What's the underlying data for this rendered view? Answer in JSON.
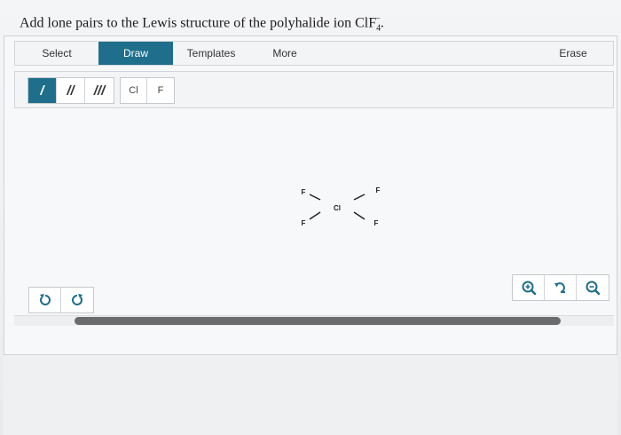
{
  "question": {
    "text": "Add lone pairs to the Lewis structure of the polyhalide ion ClF",
    "subscript": "4",
    "superscript": "−",
    "end": "."
  },
  "toolbar": {
    "select_label": "Select",
    "draw_label": "Draw",
    "templates_label": "Templates",
    "more_label": "More",
    "erase_label": "Erase"
  },
  "bonds": {
    "single": "/",
    "double": "//",
    "triple": "///"
  },
  "atoms": {
    "cl": "Cl",
    "f": "F"
  },
  "molecule": {
    "center": "Cl",
    "ligands": [
      "F",
      "F",
      "F",
      "F"
    ]
  },
  "colors": {
    "accent": "#1e6e8c",
    "icon": "#1e6e8c",
    "scrollbar": "#6a6c6e"
  },
  "icons": {
    "undo": "undo-icon",
    "redo": "redo-icon",
    "zoom_in": "zoom-in-icon",
    "reset": "reset-zoom-icon",
    "zoom_out": "zoom-out-icon"
  }
}
